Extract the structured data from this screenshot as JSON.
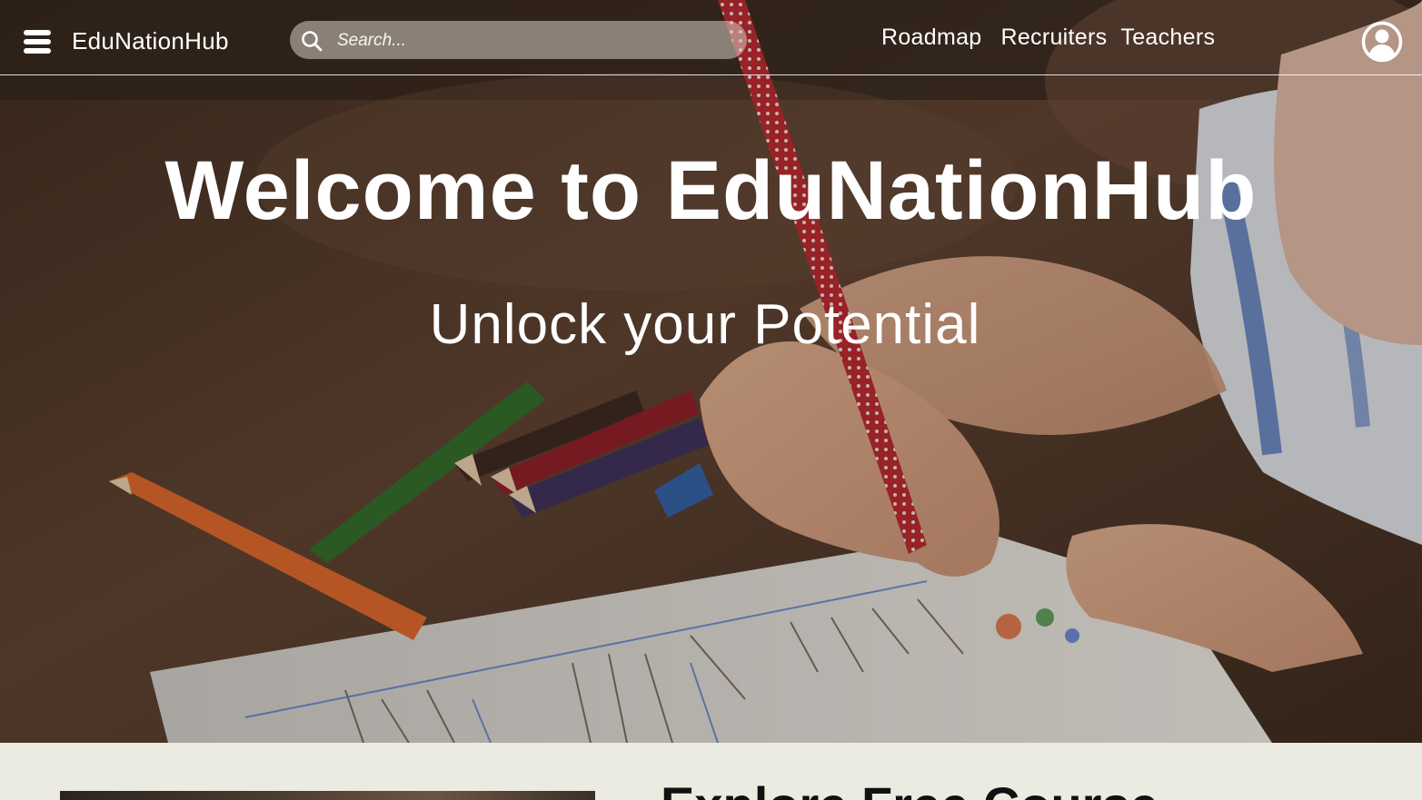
{
  "header": {
    "brand": "EduNationHub",
    "search_placeholder": "Search...",
    "nav": [
      {
        "label": "Roadmap"
      },
      {
        "label": "Recruiters"
      },
      {
        "label": "Teachers"
      }
    ]
  },
  "hero": {
    "title": "Welcome to EduNationHub",
    "subtitle": "Unlock your Potential"
  },
  "section": {
    "heading": "Explore Free Course"
  },
  "icons": {
    "menu": "hamburger-menu-icon",
    "search": "search-icon",
    "account": "user-account-icon"
  },
  "colors": {
    "text_on_hero": "#ffffff",
    "section_bg": "#ebebe1",
    "heading": "#111111"
  }
}
